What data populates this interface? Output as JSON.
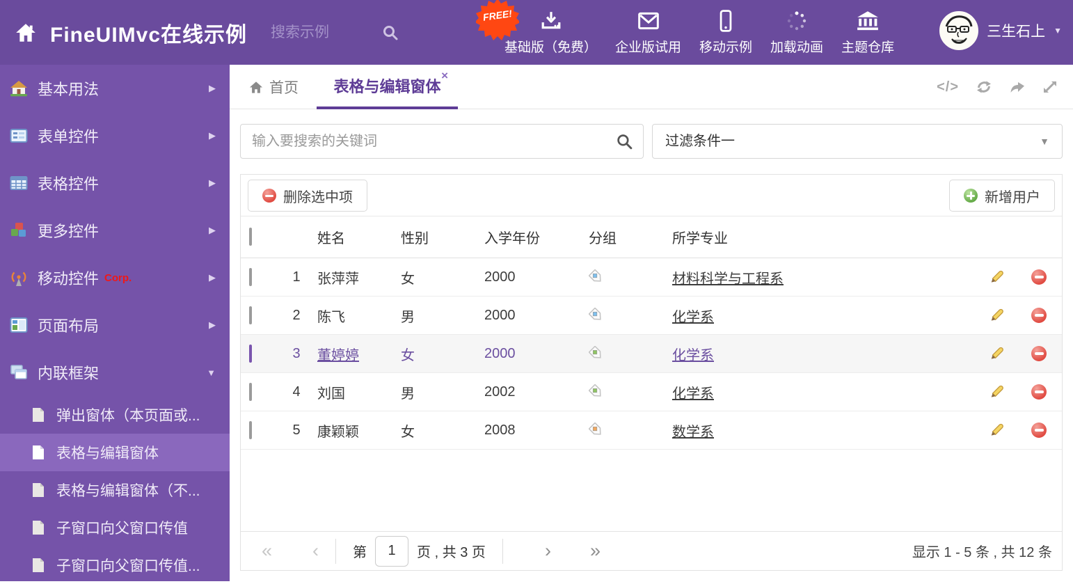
{
  "header": {
    "title": "FineUIMvc在线示例",
    "search_placeholder": "搜索示例",
    "free_badge": "FREE!",
    "nav": [
      {
        "label": "基础版（免费）",
        "icon": "download-icon"
      },
      {
        "label": "企业版试用",
        "icon": "envelope-icon"
      },
      {
        "label": "移动示例",
        "icon": "mobile-icon"
      },
      {
        "label": "加载动画",
        "icon": "spinner-icon"
      },
      {
        "label": "主题仓库",
        "icon": "bank-icon"
      }
    ],
    "user_name": "三生石上"
  },
  "icons": {
    "caret_down": "▼",
    "caret_right": "▶",
    "close_glyph": "×",
    "code_glyph": "</>"
  },
  "sidebar": {
    "items": [
      {
        "label": "基本用法",
        "icon": "home"
      },
      {
        "label": "表单控件",
        "icon": "form"
      },
      {
        "label": "表格控件",
        "icon": "table"
      },
      {
        "label": "更多控件",
        "icon": "cubes"
      },
      {
        "label": "移动控件",
        "badge": "Corp.",
        "icon": "antenna"
      },
      {
        "label": "页面布局",
        "icon": "layout"
      },
      {
        "label": "内联框架",
        "icon": "frames",
        "expanded": true
      }
    ],
    "subitems": [
      {
        "label": "弹出窗体（本页面或...",
        "active": false
      },
      {
        "label": "表格与编辑窗体",
        "active": true
      },
      {
        "label": "表格与编辑窗体（不...",
        "active": false
      },
      {
        "label": "子窗口向父窗口传值",
        "active": false
      },
      {
        "label": "子窗口向父窗口传值...",
        "active": false
      }
    ]
  },
  "tabs": {
    "home_label": "首页",
    "active_label": "表格与编辑窗体"
  },
  "filter": {
    "search_placeholder": "输入要搜索的关键词",
    "selected": "过滤条件一"
  },
  "grid": {
    "delete_label": "删除选中项",
    "add_label": "新增用户",
    "columns": {
      "name": "姓名",
      "gender": "性别",
      "year": "入学年份",
      "group": "分组",
      "major": "所学专业"
    },
    "rows": [
      {
        "num": "1",
        "name": "张萍萍",
        "gender": "女",
        "year": "2000",
        "tag": "#7ec0ee",
        "major": "材料科学与工程系",
        "selected": false
      },
      {
        "num": "2",
        "name": "陈飞",
        "gender": "男",
        "year": "2000",
        "tag": "#7ec0ee",
        "major": "化学系",
        "selected": false
      },
      {
        "num": "3",
        "name": "董婷婷",
        "gender": "女",
        "year": "2000",
        "tag": "#8fc563",
        "major": "化学系",
        "selected": true
      },
      {
        "num": "4",
        "name": "刘国",
        "gender": "男",
        "year": "2002",
        "tag": "#8fc563",
        "major": "化学系",
        "selected": false
      },
      {
        "num": "5",
        "name": "康颖颖",
        "gender": "女",
        "year": "2008",
        "tag": "#f0a85f",
        "major": "数学系",
        "selected": false
      }
    ]
  },
  "pagination": {
    "first": "«",
    "prev": "‹",
    "page_prefix": "第",
    "page_value": "1",
    "page_suffix": "页 , 共 3 页",
    "next": "›",
    "last": "»",
    "summary": "显示 1 - 5 条 , 共 12 条"
  },
  "colors": {
    "header_bg": "#6a4b9d",
    "sidebar_bg": "#7553a9",
    "sidebar_active_bg": "#8a68bd",
    "accent_purple": "#5e3c96",
    "free_badge_red": "#ff4712",
    "delete_red": "#e04a41",
    "add_green": "#61a844",
    "tag_blue": "#7ec0ee",
    "tag_green": "#8fc563",
    "tag_orange": "#f0a85f"
  }
}
